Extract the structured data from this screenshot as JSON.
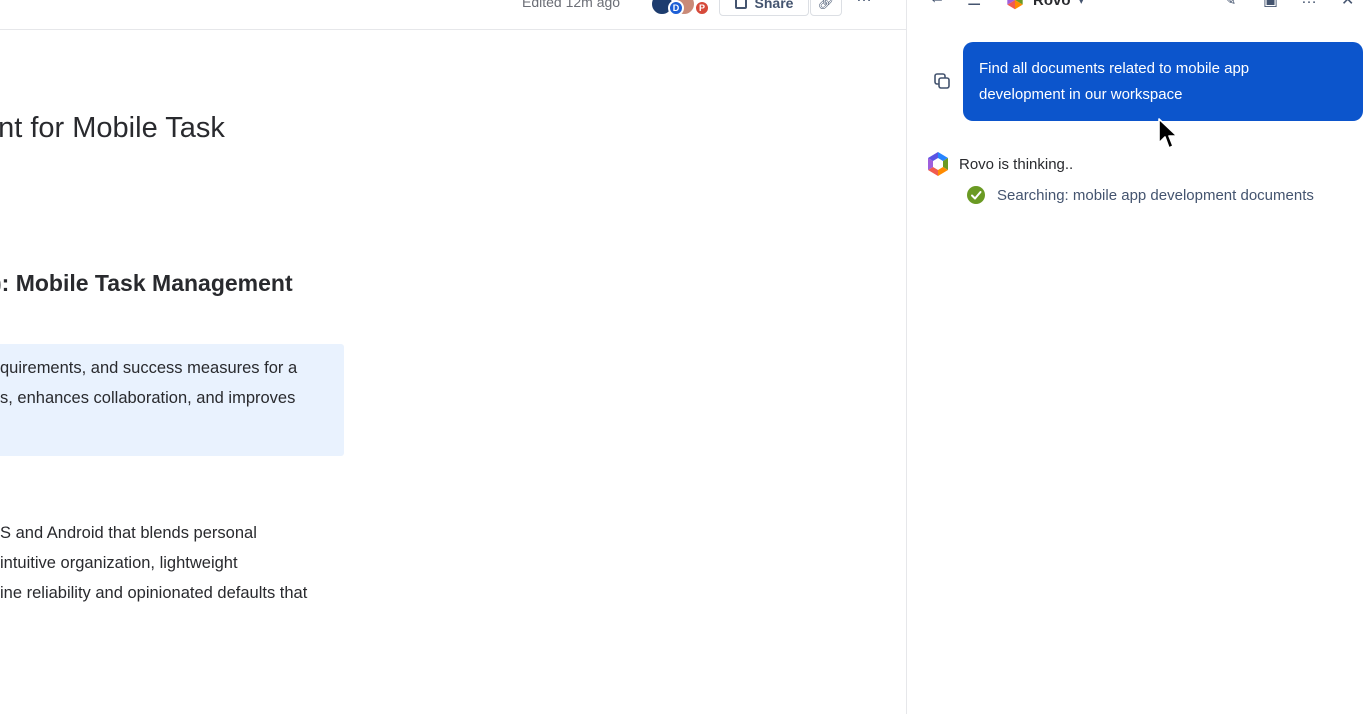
{
  "header": {
    "edited_label": "Edited 12m ago",
    "share_label": "Share",
    "avatar_initials": [
      "D",
      "P"
    ]
  },
  "document": {
    "title": "ent for Mobile Task",
    "heading": "): Mobile Task Management",
    "summary_lines": [
      "quirements, and success measures for a",
      "s, enhances collaboration, and improves"
    ],
    "body_lines": [
      "S and Android that blends personal",
      "intuitive organization, lightweight",
      "ine reliability and opinionated defaults that"
    ]
  },
  "rovo": {
    "brand": "Rovo",
    "user_message_line1": "Find all documents related to mobile app",
    "user_message_line2": "development in our workspace",
    "thinking_text": "Rovo is thinking..",
    "search_status": "Searching: mobile app development documents"
  },
  "colors": {
    "bubble": "#0c55cc",
    "summary_panel": "#e9f2fe",
    "success": "#6a9a23"
  }
}
